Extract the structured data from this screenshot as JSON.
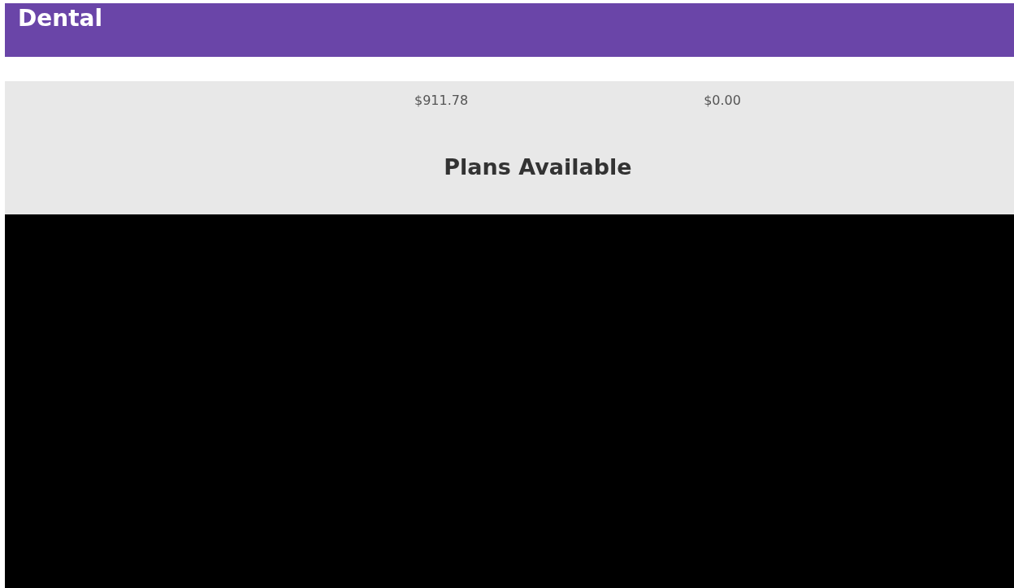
{
  "header": {
    "title": "Dental"
  },
  "summary": [
    {
      "value": "$911.78"
    },
    {
      "value": "$0.00"
    }
  ],
  "plans": {
    "heading": "Plans Available"
  }
}
